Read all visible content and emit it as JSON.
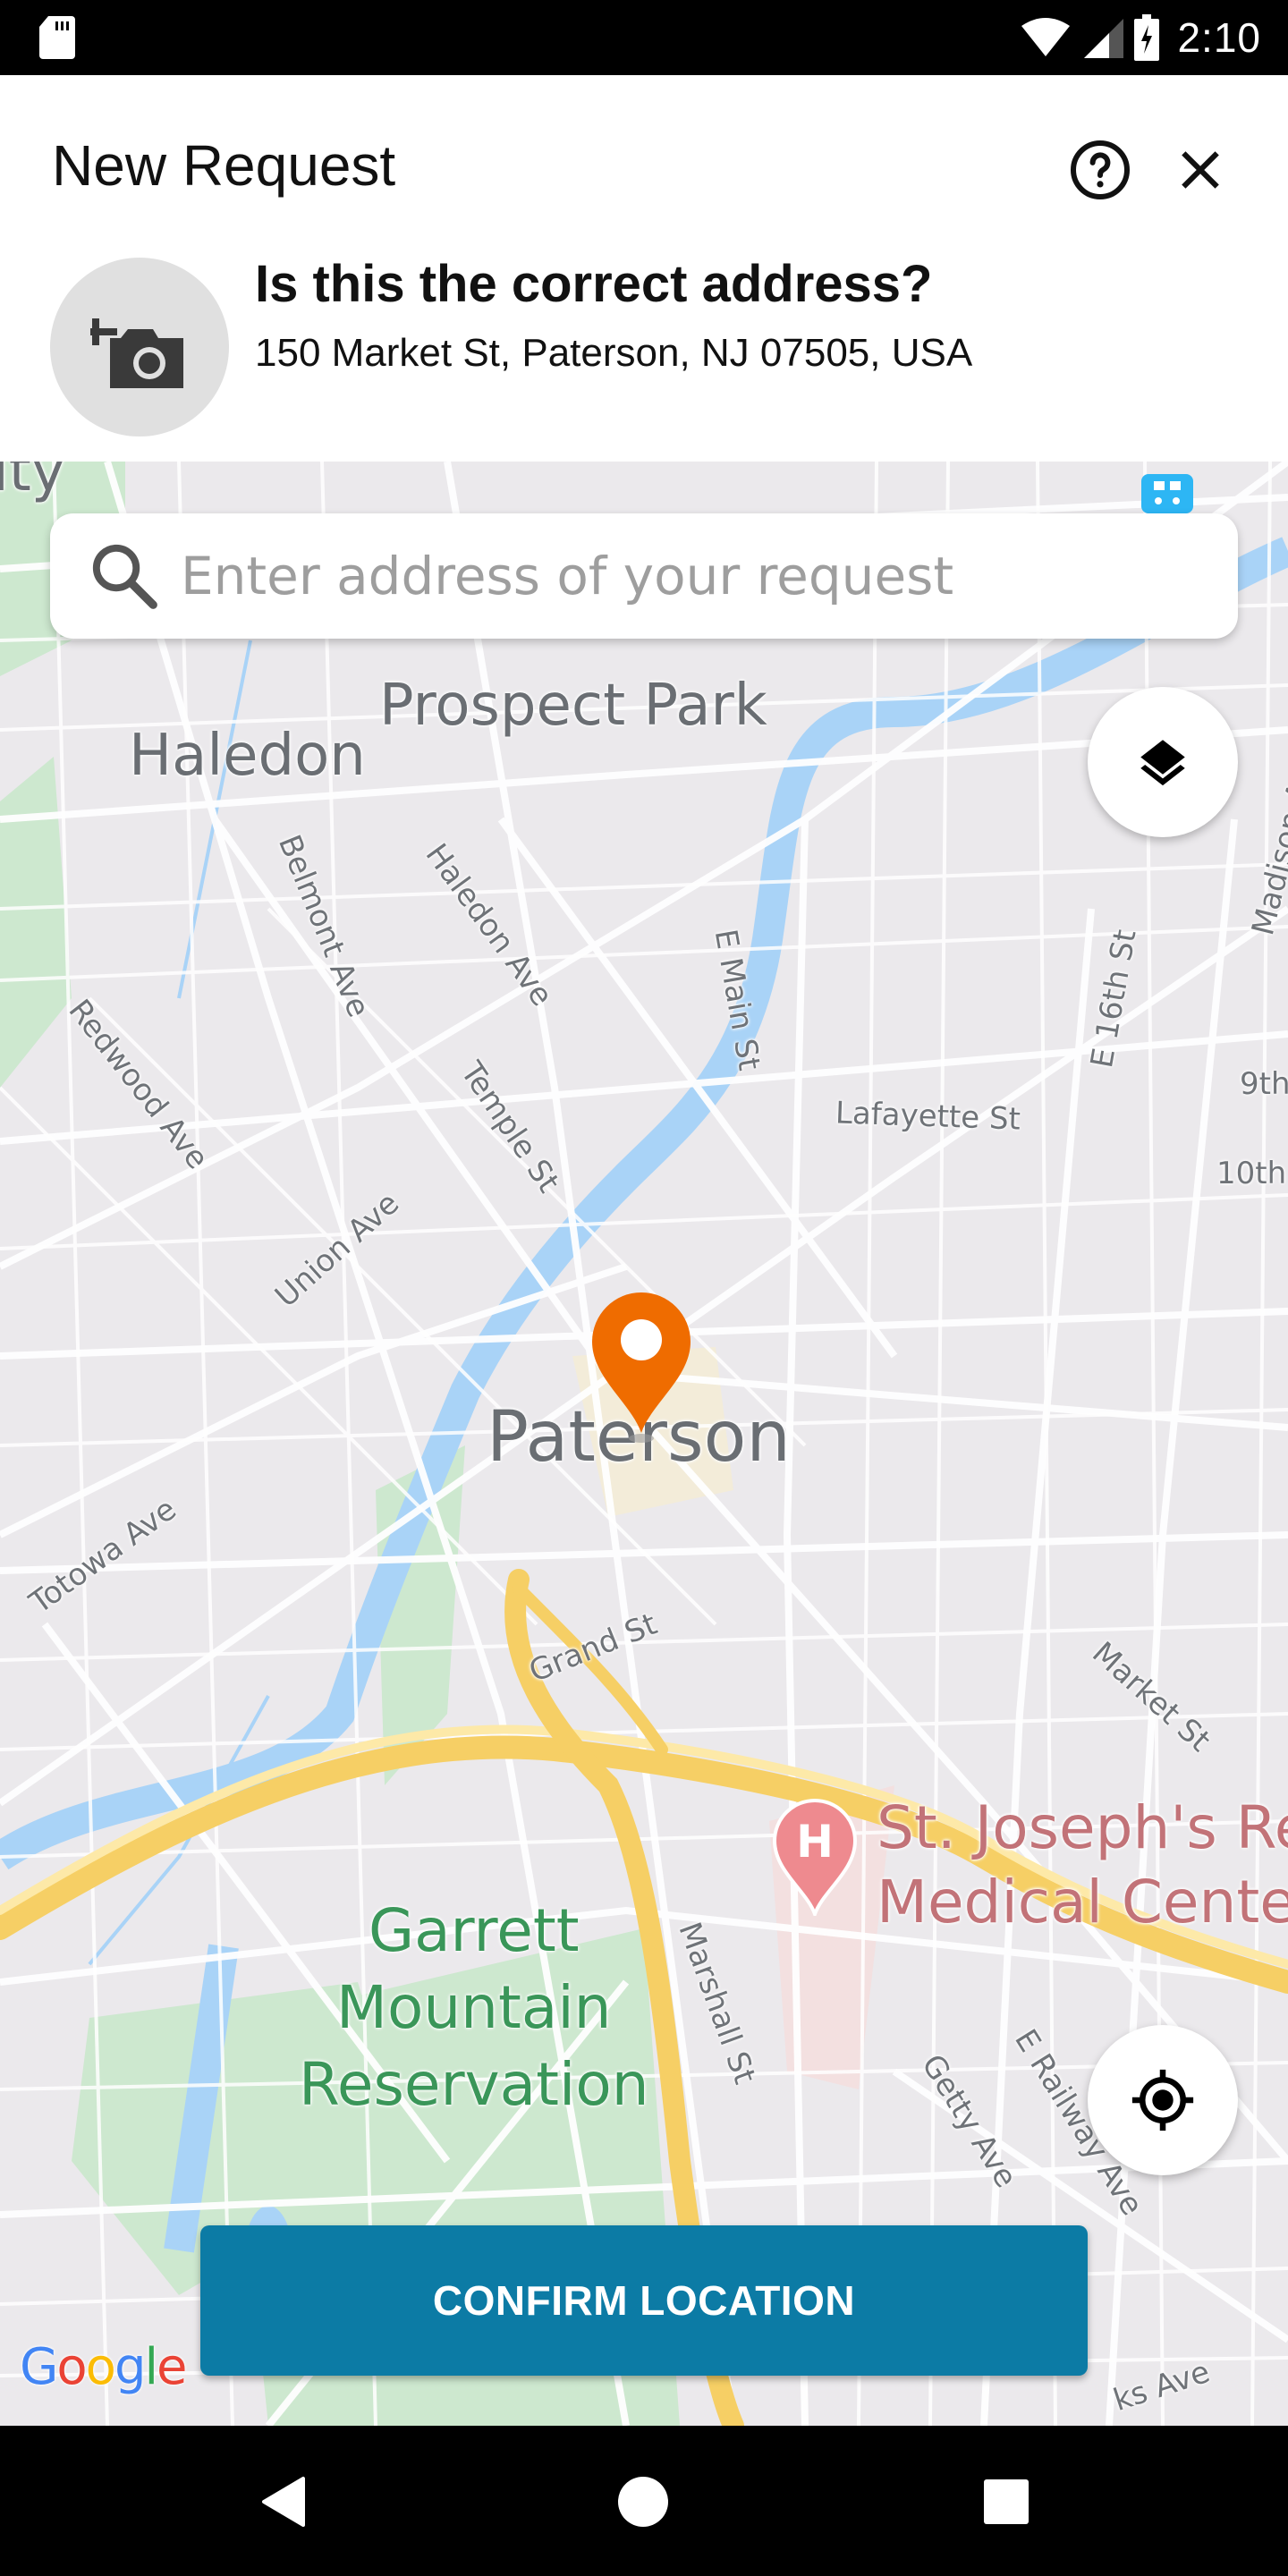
{
  "status_bar": {
    "time": "2:10",
    "icons": [
      "sd-card-icon",
      "wifi-icon",
      "cell-signal-icon",
      "battery-charging-icon"
    ]
  },
  "header": {
    "title": "New Request",
    "help_icon": "help-circle-icon",
    "close_icon": "close-icon",
    "photo_icon": "add-photo-icon",
    "question": "Is this the correct address?",
    "address": "150 Market St, Paterson, NJ 07505, USA"
  },
  "search": {
    "placeholder": "Enter address of your request",
    "value": ""
  },
  "map": {
    "labels": {
      "prospect_park": "Prospect Park",
      "haledon": "Haledon",
      "paterson": "Paterson",
      "garrett": "Garrett\nMountain\nReservation",
      "hospital": "St. Joseph's Regional\nMedical Center",
      "haledon_ave": "Haledon Ave",
      "belmont_ave": "Belmont Ave",
      "e_main_st": "E Main St",
      "redwood_ave": "Redwood Ave",
      "temple_st": "Temple St",
      "lafayette_st": "Lafayette St",
      "e16th_st": "E 16th St",
      "ninth": "9th",
      "tenth": "10th",
      "madison_ave": "Madison Ave",
      "union_ave": "Union Ave",
      "totowa_ave": "Totowa Ave",
      "grand_st": "Grand St",
      "market_st": "Market St",
      "marshall_st": "Marshall St",
      "getty_ave": "Getty Ave",
      "e_railway_ave": "E Railway Ave",
      "university": "ity",
      "park_ave": "ks Ave"
    },
    "marker_color": "#ef6c00",
    "attribution": "Google"
  },
  "controls": {
    "layers_icon": "layers-icon",
    "locate_icon": "my-location-icon",
    "confirm_label": "CONFIRM LOCATION",
    "confirm_color": "#0c7ba5"
  },
  "nav_bar": {
    "back_icon": "back-icon",
    "home_icon": "home-icon",
    "recents_icon": "recents-icon"
  }
}
